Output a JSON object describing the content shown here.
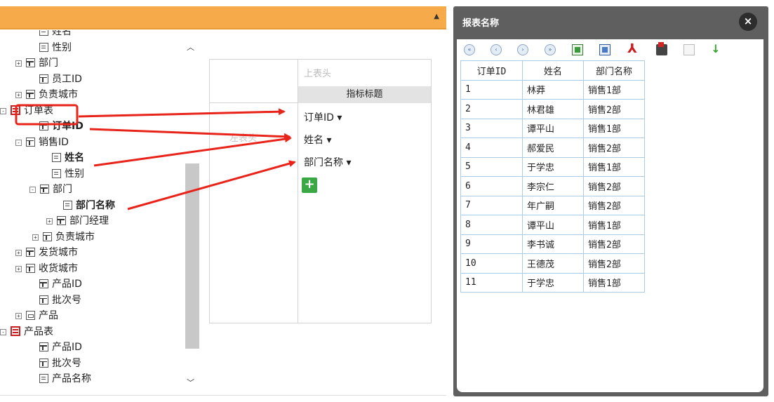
{
  "tree": {
    "items": [
      {
        "label": "姓名",
        "icon": "field"
      },
      {
        "label": "性别",
        "icon": "field"
      },
      {
        "label": "部门",
        "icon": "dim",
        "toggle": "+"
      },
      {
        "label": "员工ID",
        "icon": "dim"
      },
      {
        "label": "负责城市",
        "icon": "dim",
        "toggle": "+"
      },
      {
        "label": "订单表",
        "icon": "table",
        "toggle": "−"
      },
      {
        "label": "订单ID",
        "icon": "dim"
      },
      {
        "label": "销售ID",
        "icon": "dim",
        "toggle": "−"
      },
      {
        "label": "姓名",
        "icon": "field"
      },
      {
        "label": "性别",
        "icon": "field"
      },
      {
        "label": "部门",
        "icon": "dim",
        "toggle": "−"
      },
      {
        "label": "部门名称",
        "icon": "field"
      },
      {
        "label": "部门经理",
        "icon": "dim",
        "toggle": "+"
      },
      {
        "label": "负责城市",
        "icon": "dim",
        "toggle": "+"
      },
      {
        "label": "发货城市",
        "icon": "dim",
        "toggle": "+"
      },
      {
        "label": "收货城市",
        "icon": "dim",
        "toggle": "+"
      },
      {
        "label": "产品ID",
        "icon": "dim"
      },
      {
        "label": "批次号",
        "icon": "dim"
      },
      {
        "label": "产品",
        "icon": "box",
        "toggle": "+"
      },
      {
        "label": "产品表",
        "icon": "table",
        "toggle": "−"
      },
      {
        "label": "产品ID",
        "icon": "dim"
      },
      {
        "label": "批次号",
        "icon": "dim"
      },
      {
        "label": "产品名称",
        "icon": "field"
      }
    ]
  },
  "designer": {
    "top_header": "上表头",
    "indicator_title": "指标标题",
    "left_header": "左表头",
    "slots": [
      "订单ID ▾",
      "姓名 ▾",
      "部门名称 ▾"
    ],
    "add_label": "+"
  },
  "report": {
    "title": "报表名称",
    "close_label": "×",
    "toolbar": [
      "first-page",
      "prev-page",
      "next-page",
      "last-page",
      "export-excel",
      "export-word",
      "export-pdf",
      "print",
      "export-doc",
      "download"
    ],
    "columns": [
      "订单ID",
      "姓名",
      "部门名称"
    ],
    "rows": [
      [
        "1",
        "林莽",
        "销售1部"
      ],
      [
        "2",
        "林君雄",
        "销售2部"
      ],
      [
        "3",
        "谭平山",
        "销售1部"
      ],
      [
        "4",
        "郝爱民",
        "销售2部"
      ],
      [
        "5",
        "于学忠",
        "销售1部"
      ],
      [
        "6",
        "李宗仁",
        "销售2部"
      ],
      [
        "7",
        "年广嗣",
        "销售2部"
      ],
      [
        "8",
        "谭平山",
        "销售1部"
      ],
      [
        "9",
        "李书诚",
        "销售2部"
      ],
      [
        "10",
        "王德茂",
        "销售2部"
      ],
      [
        "11",
        "于学忠",
        "销售1部"
      ]
    ]
  },
  "colors": {
    "header_orange": "#f7aa4a",
    "highlight_red": "#e8241a",
    "add_green": "#3aa845",
    "window_gray": "#5f5f5f"
  }
}
